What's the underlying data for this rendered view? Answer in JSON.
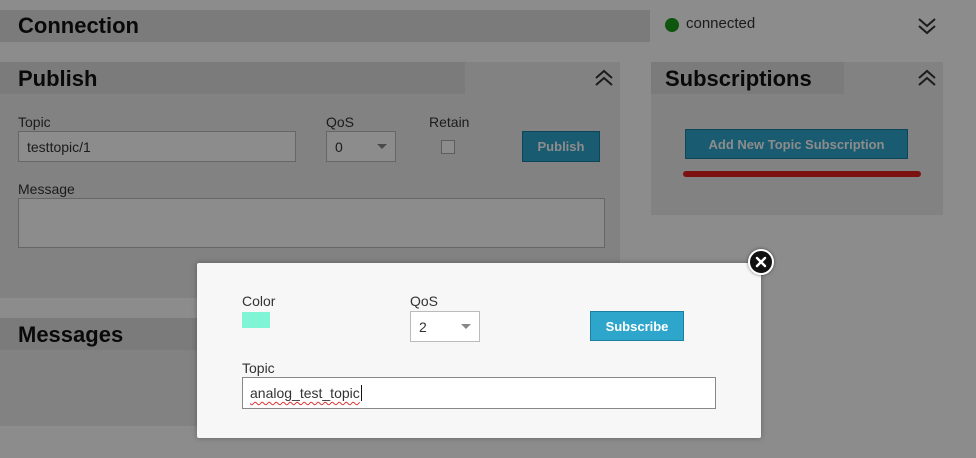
{
  "colors": {
    "accent_button": "#2ea6cc",
    "status_connected": "#1a9b1a",
    "subscription_color": "#7ff5d6",
    "annotation_red": "#e02020"
  },
  "connection": {
    "title": "Connection",
    "status": "connected",
    "chevron": "chevron-double-down-icon"
  },
  "publish": {
    "title": "Publish",
    "chevron": "chevron-double-up-icon",
    "topic_label": "Topic",
    "topic_value": "testtopic/1",
    "qos_label": "QoS",
    "qos_value": "0",
    "retain_label": "Retain",
    "publish_button": "Publish",
    "message_label": "Message",
    "message_value": ""
  },
  "subscriptions": {
    "title": "Subscriptions",
    "chevron": "chevron-double-up-icon",
    "add_button": "Add New Topic Subscription"
  },
  "messages": {
    "title": "Messages"
  },
  "modal": {
    "color_label": "Color",
    "qos_label": "QoS",
    "qos_value": "2",
    "subscribe_button": "Subscribe",
    "topic_label": "Topic",
    "topic_value": "analog_test_topic"
  }
}
